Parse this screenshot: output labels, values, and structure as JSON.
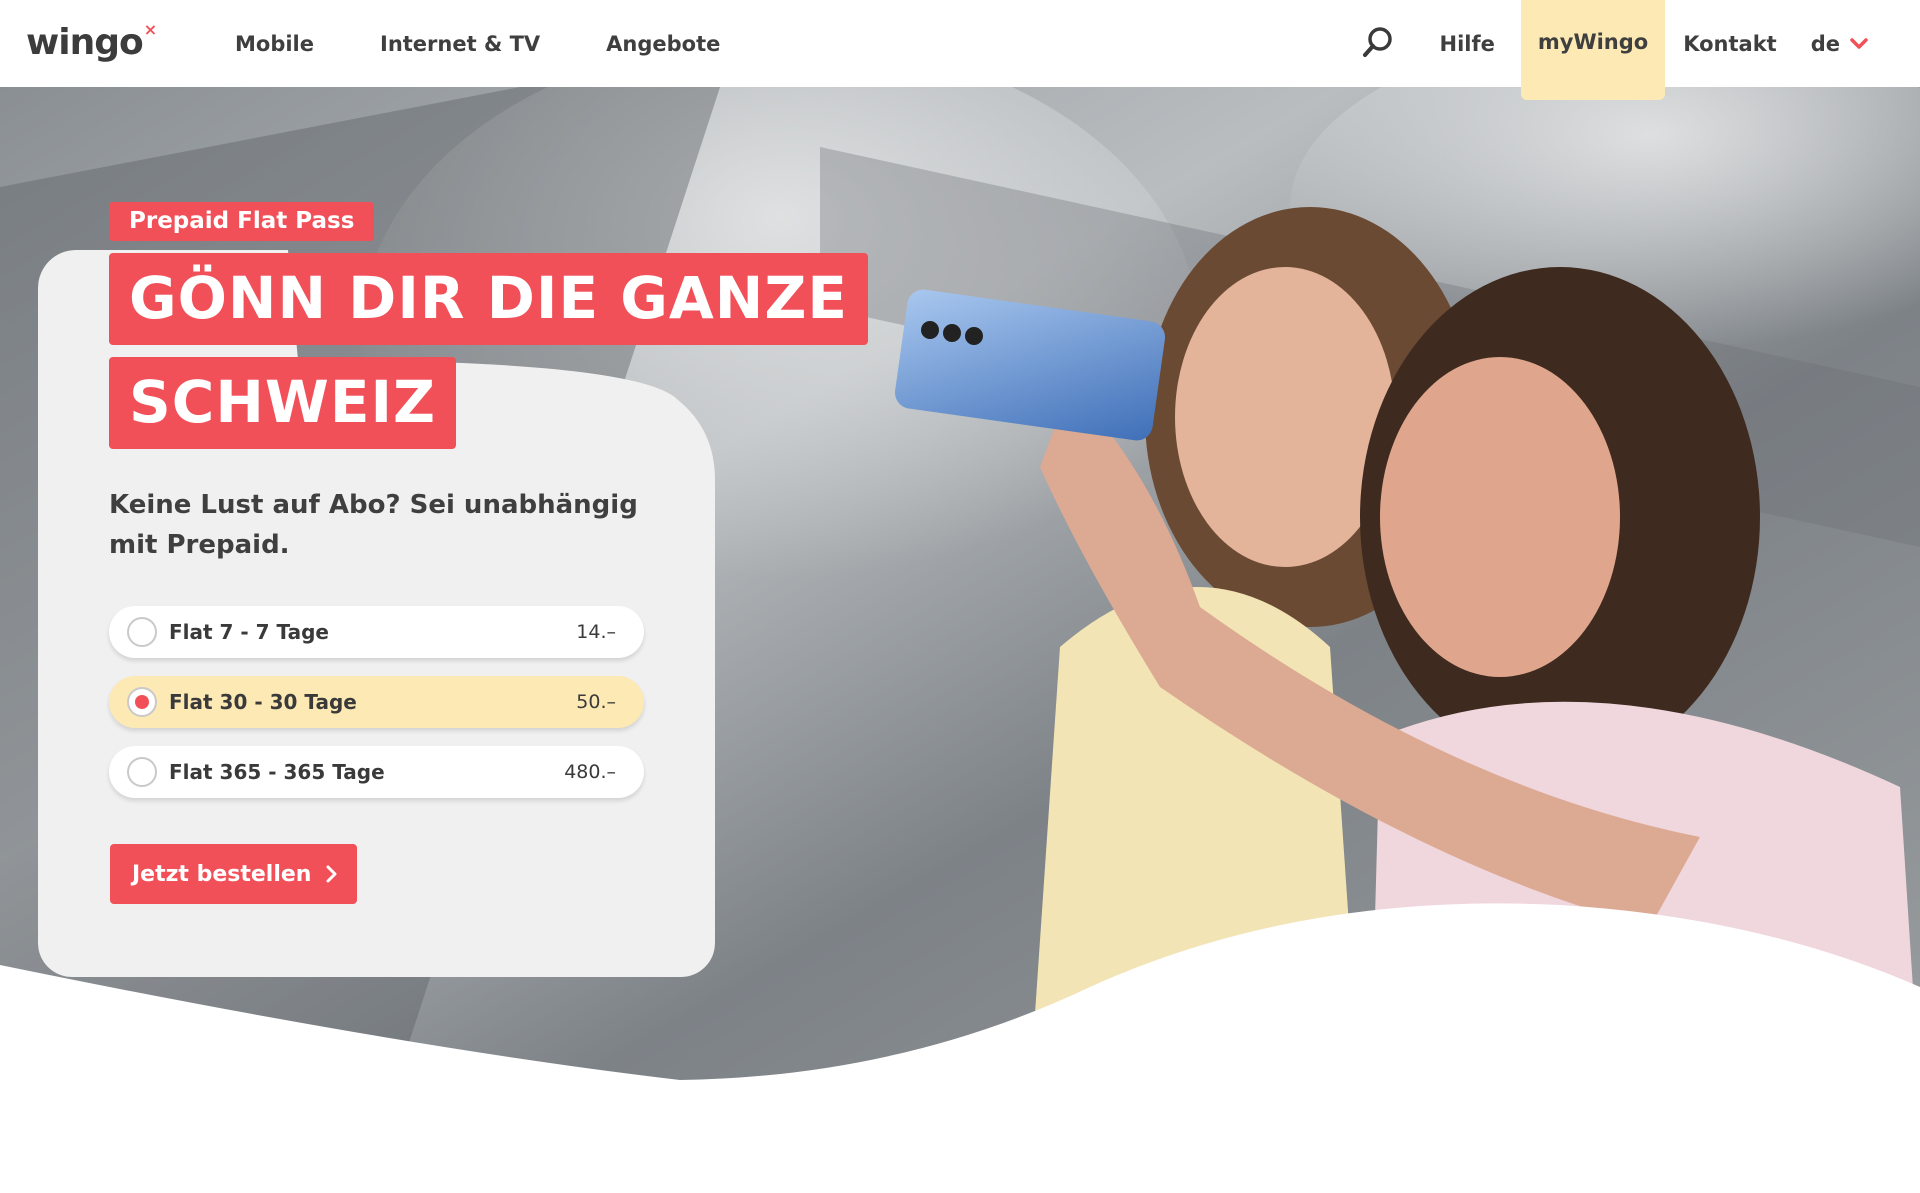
{
  "header": {
    "logo": {
      "text": "wingo",
      "mark": "×"
    },
    "nav_left": [
      "Mobile",
      "Internet & TV",
      "Angebote"
    ],
    "nav_right": {
      "help": "Hilfe",
      "account": "myWingo",
      "contact": "Kontakt",
      "language": "de"
    },
    "icons": [
      "search-icon",
      "chevron-down-icon"
    ]
  },
  "hero": {
    "tag": "Prepaid Flat Pass",
    "headline_1": "GÖNN DIR DIE GANZE",
    "headline_2": "SCHWEIZ",
    "subline": "Keine Lust auf Abo? Sei unabhängig mit Prepaid.",
    "options": [
      {
        "label": "Flat 7 - 7 Tage",
        "price": "14.–",
        "selected": false
      },
      {
        "label": "Flat 30 - 30 Tage",
        "price": "50.–",
        "selected": true
      },
      {
        "label": "Flat 365 - 365 Tage",
        "price": "480.–",
        "selected": false
      }
    ],
    "cta": "Jetzt bestellen"
  },
  "colors": {
    "accent": "#f25059",
    "highlight": "#fce9b4",
    "card": "#f0f0f0",
    "text": "#3a3a3a"
  }
}
